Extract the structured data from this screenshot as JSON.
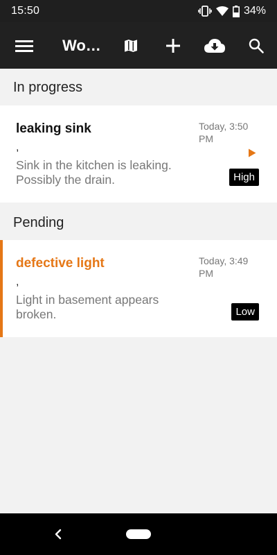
{
  "status_bar": {
    "time": "15:50",
    "battery": "34%"
  },
  "app_bar": {
    "title": "Wo…"
  },
  "sections": [
    {
      "label": "In progress"
    },
    {
      "label": "Pending"
    }
  ],
  "cards": [
    {
      "title": "leaking sink",
      "comma": ",",
      "description": "Sink in the kitchen is leaking. Possibly the drain.",
      "time": "Today, 3:50 PM",
      "priority": "High"
    },
    {
      "title": "defective light",
      "comma": ",",
      "description": "Light in basement appears broken.",
      "time": "Today, 3:49 PM",
      "priority": "Low"
    }
  ],
  "colors": {
    "accent": "#e57716",
    "app_bar": "#212121",
    "status_bar": "#1f1f1f",
    "background": "#f2f2f2"
  }
}
